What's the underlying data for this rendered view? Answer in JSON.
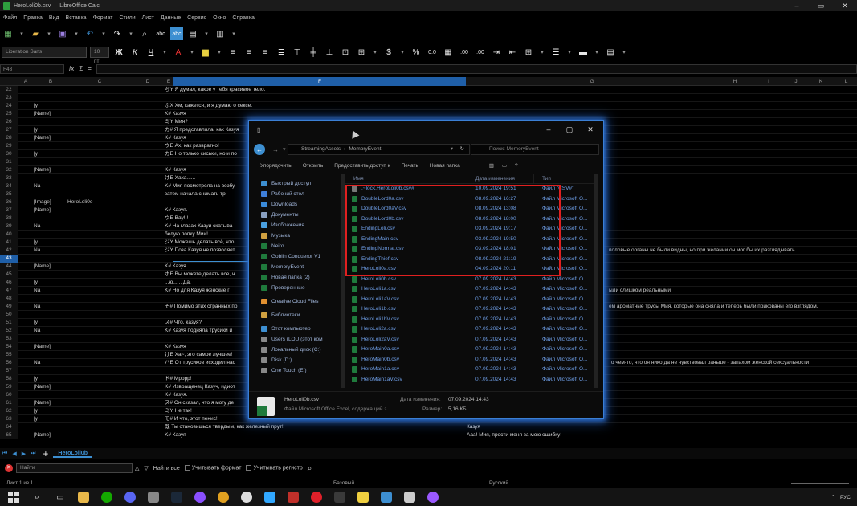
{
  "app": {
    "title": "HeroLoli0b.csv — LibreOffice Calc",
    "menu": [
      "Файл",
      "Правка",
      "Вид",
      "Вставка",
      "Формат",
      "Стили",
      "Лист",
      "Данные",
      "Сервис",
      "Окно",
      "Справка"
    ]
  },
  "toolbar": {
    "font_name": "Liberation Sans",
    "font_size": "10 пт",
    "bold": "Ж",
    "italic": "К",
    "underline": "Ч",
    "currency": "$",
    "percent": "%",
    "decimal_0": "0.0",
    "decimal_00": ".00",
    "spell": "abc",
    "autospell": "abc"
  },
  "formula_bar": {
    "cell_ref": "F43",
    "fx": "fx",
    "sum": "Σ",
    "equals": "="
  },
  "columns": [
    {
      "label": "A"
    },
    {
      "label": "B"
    },
    {
      "label": "C"
    },
    {
      "label": "D"
    },
    {
      "label": "E"
    },
    {
      "label": "F"
    },
    {
      "label": "G"
    },
    {
      "label": "H"
    },
    {
      "label": "I"
    },
    {
      "label": "J"
    },
    {
      "label": "K"
    },
    {
      "label": "L"
    }
  ],
  "rows": [
    {
      "n": "22",
      "b": "",
      "c": "",
      "e": "ちY Я думал, какое у тебя красивое тело.",
      "r": ""
    },
    {
      "n": "23",
      "b": "",
      "c": "",
      "e": "",
      "r": ""
    },
    {
      "n": "24",
      "b": "[у",
      "c": "",
      "e": "ふX Хм, кажется, и я думаю о сексе.",
      "r": ""
    },
    {
      "n": "25",
      "b": "[Name]",
      "c": "",
      "e": "K# Казуя",
      "r": ""
    },
    {
      "n": "26",
      "b": "",
      "c": "",
      "e": "ミY Мия?",
      "r": ""
    },
    {
      "n": "27",
      "b": "[у",
      "c": "",
      "e": "カ# Я представляла, как Казуя",
      "r": ""
    },
    {
      "n": "28",
      "b": "[Name]",
      "c": "",
      "e": "K# Казуя",
      "r": ""
    },
    {
      "n": "29",
      "b": "",
      "c": "",
      "e": "ウE Ах, как развратно!",
      "r": ""
    },
    {
      "n": "30",
      "b": "[у",
      "c": "",
      "e": "カE Но только сиськи, но и по",
      "r": ""
    },
    {
      "n": "31",
      "b": "",
      "c": "",
      "e": "",
      "r": ""
    },
    {
      "n": "32",
      "b": "[Name]",
      "c": "",
      "e": "K# Казуя",
      "r": ""
    },
    {
      "n": "33",
      "b": "",
      "c": "",
      "e": "けE Хаха......",
      "r": ""
    },
    {
      "n": "34",
      "b": "Na",
      "c": "",
      "e": "K# Мия посмотрела на возбу",
      "r": ""
    },
    {
      "n": "35",
      "b": "",
      "c": "",
      "e": "     затем начала снимать тр",
      "r": ""
    },
    {
      "n": "36",
      "b": "[Image]",
      "c": "HeroLoli0e",
      "e": "",
      "r": ""
    },
    {
      "n": "37",
      "b": "[Name]",
      "c": "",
      "e": "K# Казуя.",
      "r": ""
    },
    {
      "n": "38",
      "b": "",
      "c": "",
      "e": "ウE Вау!!!",
      "r": ""
    },
    {
      "n": "39",
      "b": "Na",
      "c": "",
      "e": "K# На глазах Казуи скатыва",
      "r": ""
    },
    {
      "n": "40",
      "b": "",
      "c": "",
      "e": "     белую попку Мии!",
      "r": ""
    },
    {
      "n": "41",
      "b": "[у",
      "c": "",
      "e": "ジY Можешь делать всё, что",
      "r": ""
    },
    {
      "n": "42",
      "b": "Na",
      "c": "",
      "e": "ジY Поза Казуя не позволяет",
      "r": "половые органы не были видны, но при желании он мог бы их разглядывать."
    },
    {
      "n": "43",
      "b": "",
      "c": "",
      "e": "",
      "r": "",
      "cursor": true
    },
    {
      "n": "44",
      "b": "[Name]",
      "c": "",
      "e": "K# Казуя.",
      "r": ""
    },
    {
      "n": "45",
      "b": "",
      "c": "",
      "e": "ホE Вы можете делать все, ч",
      "r": ""
    },
    {
      "n": "46",
      "b": "[у",
      "c": "",
      "e": "...ю......   Да.",
      "r": ""
    },
    {
      "n": "47",
      "b": "Na",
      "c": "",
      "e": "K# Но для Казуя женские г",
      "r": "ыли слишком реальными"
    },
    {
      "n": "48",
      "b": "",
      "c": "",
      "e": "",
      "r": ""
    },
    {
      "n": "49",
      "b": "Na",
      "c": "",
      "e": "そ# Помимо этих странных пр",
      "r": "ем ароматные трусы Мия, которые она сняла и теперь были прикованы его взглядом."
    },
    {
      "n": "50",
      "b": "",
      "c": "",
      "e": "",
      "r": ""
    },
    {
      "n": "51",
      "b": "[у",
      "c": "",
      "e": "ス# Что, казуя?",
      "r": ""
    },
    {
      "n": "52",
      "b": "Na",
      "c": "",
      "e": "K# Казуя подняла трусики и",
      "r": ""
    },
    {
      "n": "53",
      "b": "",
      "c": "",
      "e": "",
      "r": ""
    },
    {
      "n": "54",
      "b": "[Name]",
      "c": "",
      "e": "K# Казуя",
      "r": ""
    },
    {
      "n": "55",
      "b": "",
      "c": "",
      "e": "けE Ха~, это самое лучшее!",
      "r": ""
    },
    {
      "n": "56",
      "b": "Na",
      "c": "",
      "e": "ハE От трусиков исходил нас",
      "r": "то чем-то, что он никогда не чувствовал раньше - запахом женской сексуальности"
    },
    {
      "n": "57",
      "b": "",
      "c": "",
      "e": "",
      "r": ""
    },
    {
      "n": "58",
      "b": "[у",
      "c": "",
      "e": "ド# Мрррр!",
      "r": ""
    },
    {
      "n": "59",
      "b": "[Name]",
      "c": "",
      "e": "K# Извращенец Казуч, идиот",
      "r": ""
    },
    {
      "n": "60",
      "b": "",
      "c": "",
      "e": "K# Казуя.",
      "r": ""
    },
    {
      "n": "61",
      "b": "[Name]",
      "c": "",
      "e": "ス# Он сказал, что я могу де",
      "r": ""
    },
    {
      "n": "62",
      "b": "[у",
      "c": "",
      "e": "ミY Не так!",
      "r": ""
    },
    {
      "n": "63",
      "b": "[у",
      "c": "",
      "e": "モ# И что, этот пенис!",
      "r": ""
    },
    {
      "n": "64",
      "b": "",
      "c": "",
      "e": "既 Ты становишься твердым, как железный прут!",
      "r": "",
      "g": "Казуя"
    },
    {
      "n": "65",
      "b": "[Name]",
      "c": "",
      "e": "K# Казуя",
      "r": "",
      "g": "Ааа! Мия, прости меня за мою ошибку!"
    }
  ],
  "sheet_tabs": {
    "active": "HeroLoli0b"
  },
  "find_bar": {
    "placeholder": "Найти",
    "find_all": "Найти все",
    "match_format": "Учитывать формат",
    "match_case": "Учитывать регистр"
  },
  "status": {
    "sheet": "Лист 1 из 1",
    "style": "Базовый",
    "language": "Русский"
  },
  "explorer": {
    "path_parent": "StreamingAssets",
    "path_current": "MemoryEvent",
    "search_placeholder": "Поиск: MemoryEvent",
    "commands": [
      "Упорядочить",
      "Открыть",
      "Предоставить доступ к",
      "Печать",
      "Новая папка"
    ],
    "nav": [
      {
        "label": "Быстрый доступ",
        "kind": "header",
        "color": "#3d8fd1"
      },
      {
        "label": "Рабочий стол",
        "color": "#3f7fd8"
      },
      {
        "label": "Downloads",
        "color": "#3a8ad8"
      },
      {
        "label": "Документы",
        "color": "#8aa0c0"
      },
      {
        "label": "Изображения",
        "color": "#4aa0e0"
      },
      {
        "label": "Музыка",
        "color": "#d0a040"
      },
      {
        "label": "Neiro",
        "color": "#1f7a3c"
      },
      {
        "label": "Goblin Conqueror V1",
        "color": "#1f7a3c"
      },
      {
        "label": "MemoryEvent",
        "color": "#1f7a3c"
      },
      {
        "label": "Новая папка (2)",
        "color": "#1f7a3c"
      },
      {
        "label": "Проверенные",
        "color": "#1f7a3c"
      },
      {
        "label": "Creative Cloud Files",
        "kind": "header gap",
        "color": "#e09030"
      },
      {
        "label": "Библиотеки",
        "kind": "header gap",
        "color": "#d0a040"
      },
      {
        "label": "Этот компьютер",
        "kind": "header gap",
        "color": "#3d8fd1"
      },
      {
        "label": "Users (LOU (этот ком",
        "color": "#888888"
      },
      {
        "label": "Локальный диск (C:)",
        "color": "#888888"
      },
      {
        "label": "Disk (D:)",
        "color": "#888888"
      },
      {
        "label": "One Touch (E:)",
        "color": "#888888"
      }
    ],
    "headers": {
      "name": "Имя",
      "date": "Дата изменения",
      "type": "Тип"
    },
    "files": [
      {
        "name": ".~lock.HeroLoli0b.csv#",
        "date": "10.09.2024 19:51",
        "type": "Файл \"CSV#\""
      },
      {
        "name": "DoubleLord0a.csv",
        "date": "08.09.2024 16:27",
        "type": "Файл Microsoft O..."
      },
      {
        "name": "DoubleLord0aV.csv",
        "date": "08.09.2024 13:08",
        "type": "Файл Microsoft O..."
      },
      {
        "name": "DoubleLord0b.csv",
        "date": "08.09.2024 18:00",
        "type": "Файл Microsoft O..."
      },
      {
        "name": "EndingLoli.csv",
        "date": "03.09.2024 19:17",
        "type": "Файл Microsoft O..."
      },
      {
        "name": "EndingMain.csv",
        "date": "03.09.2024 19:50",
        "type": "Файл Microsoft O..."
      },
      {
        "name": "EndingNormal.csv",
        "date": "03.09.2024 18:01",
        "type": "Файл Microsoft O..."
      },
      {
        "name": "EndingThief.csv",
        "date": "08.09.2024 21:19",
        "type": "Файл Microsoft O..."
      },
      {
        "name": "HeroLoli0a.csv",
        "date": "04.09.2024 20:11",
        "type": "Файл Microsoft O..."
      },
      {
        "name": "HeroLoli0b.csv",
        "date": "07.09.2024 14:43",
        "type": "Файл Microsoft O..."
      },
      {
        "name": "HeroLoli1a.csv",
        "date": "07.09.2024 14:43",
        "type": "Файл Microsoft O..."
      },
      {
        "name": "HeroLoli1aV.csv",
        "date": "07.09.2024 14:43",
        "type": "Файл Microsoft O..."
      },
      {
        "name": "HeroLoli1b.csv",
        "date": "07.09.2024 14:43",
        "type": "Файл Microsoft O..."
      },
      {
        "name": "HeroLoli1bV.csv",
        "date": "07.09.2024 14:43",
        "type": "Файл Microsoft O..."
      },
      {
        "name": "HeroLoli2a.csv",
        "date": "07.09.2024 14:43",
        "type": "Файл Microsoft O..."
      },
      {
        "name": "HeroLoli2aV.csv",
        "date": "07.09.2024 14:43",
        "type": "Файл Microsoft O..."
      },
      {
        "name": "HeroMain0a.csv",
        "date": "07.09.2024 14:43",
        "type": "Файл Microsoft O..."
      },
      {
        "name": "HeroMain0b.csv",
        "date": "07.09.2024 14:43",
        "type": "Файл Microsoft O..."
      },
      {
        "name": "HeroMain1a.csv",
        "date": "07.09.2024 14:43",
        "type": "Файл Microsoft O..."
      },
      {
        "name": "HeroMain1aV.csv",
        "date": "07.09.2024 14:43",
        "type": "Файл Microsoft O..."
      }
    ],
    "details": {
      "name": "HeroLoli0b.csv",
      "type": "Файл Microsoft Office Excel, содержащий з...",
      "modified_label": "Дата изменения:",
      "modified": "07.09.2024 14:43",
      "size_label": "Размер:",
      "size": "5,16 КБ"
    }
  },
  "taskbar": {
    "apps": [
      {
        "name": "file-explorer-icon",
        "color": "#e8b84a"
      },
      {
        "name": "upwork-icon",
        "color": "#14a800"
      },
      {
        "name": "discord-icon",
        "color": "#5865f2"
      },
      {
        "name": "app-icon",
        "color": "#888888"
      },
      {
        "name": "steam-icon",
        "color": "#1b2838"
      },
      {
        "name": "purple-app-icon",
        "color": "#8a4fff"
      },
      {
        "name": "chrome-icon",
        "color": "#e0a020"
      },
      {
        "name": "chatgpt-icon",
        "color": "#dddddd"
      },
      {
        "name": "photoshop-icon",
        "color": "#31a8ff"
      },
      {
        "name": "red-app-icon",
        "color": "#c0302a"
      },
      {
        "name": "opera-icon",
        "color": "#e0202a"
      },
      {
        "name": "gpu-app-icon",
        "color": "#3a3a3a"
      },
      {
        "name": "notes-icon",
        "color": "#f0d040"
      },
      {
        "name": "libreoffice-icon",
        "color": "#3d8fd1"
      },
      {
        "name": "unity-icon",
        "color": "#cccccc"
      },
      {
        "name": "purple-circle-icon",
        "color": "#9b59ff"
      }
    ],
    "lang": "РУС"
  }
}
